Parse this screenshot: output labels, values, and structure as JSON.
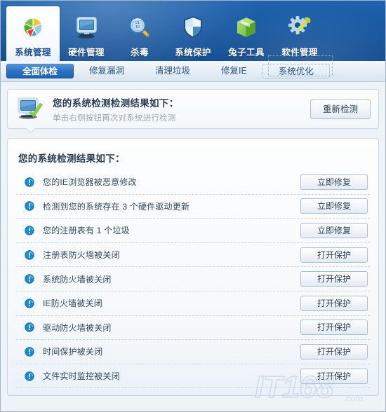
{
  "header": {
    "nav_items": [
      {
        "label": "系统管理",
        "icon": "pie-chart-icon",
        "active": true
      },
      {
        "label": "硬件管理",
        "icon": "monitor-icon",
        "active": false
      },
      {
        "label": "杀毒",
        "icon": "magnifier-icon",
        "active": false
      },
      {
        "label": "系统保护",
        "icon": "shield-icon",
        "active": false
      },
      {
        "label": "兔子工具",
        "icon": "green-box-icon",
        "active": false
      },
      {
        "label": "软件管理",
        "icon": "gear-wrench-icon",
        "active": false
      }
    ]
  },
  "tabs": [
    {
      "label": "全面体检",
      "active": true,
      "focused": false
    },
    {
      "label": "修复漏洞",
      "active": false,
      "focused": false
    },
    {
      "label": "清理垃圾",
      "active": false,
      "focused": false
    },
    {
      "label": "修复IE",
      "active": false,
      "focused": false
    },
    {
      "label": "系统优化",
      "active": false,
      "focused": true
    }
  ],
  "info_panel": {
    "icon": "monitor-check-icon",
    "title": "您的系统检测检测结果如下：",
    "subtitle": "单击右侧按钮再次对系统进行检测",
    "rescan_button": "重新检测"
  },
  "results": {
    "heading": "您的系统检测结果如下：",
    "rows": [
      {
        "icon": "warning-icon",
        "text": "您的IE浏览器被恶意修改",
        "action": "立即修复"
      },
      {
        "icon": "warning-icon",
        "text": "检测到您的系统存在 3 个硬件驱动更新",
        "action": "立即修复"
      },
      {
        "icon": "warning-icon",
        "text": "您的注册表有 1 个垃圾",
        "action": "立即修复"
      },
      {
        "icon": "warning-icon",
        "text": "注册表防火墙被关闭",
        "action": "打开保护"
      },
      {
        "icon": "warning-icon",
        "text": "系统防火墙被关闭",
        "action": "打开保护"
      },
      {
        "icon": "warning-icon",
        "text": "IE防火墙被关闭",
        "action": "打开保护"
      },
      {
        "icon": "warning-icon",
        "text": "驱动防火墙被关闭",
        "action": "打开保护"
      },
      {
        "icon": "warning-icon",
        "text": "时间保护被关闭",
        "action": "打开保护"
      },
      {
        "icon": "warning-icon",
        "text": "文件实时监控被关闭",
        "action": "打开保护"
      }
    ]
  },
  "watermark": {
    "text": "IT168",
    "suffix": ".com"
  },
  "colors": {
    "header_blue": "#14539b",
    "active_tab_blue": "#2b72c4",
    "warning_blue": "#1b8ad6",
    "panel_border": "#c9d9e8",
    "text_dark": "#2b3d52"
  }
}
